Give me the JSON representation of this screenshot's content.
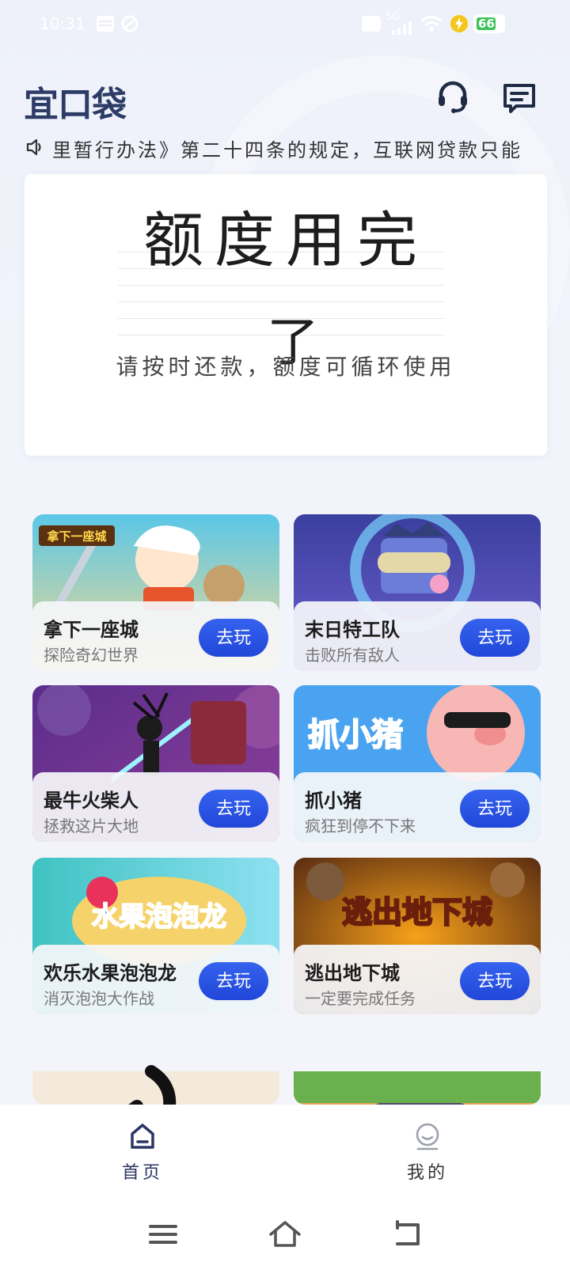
{
  "status_bar": {
    "time": "10:31",
    "battery": "66",
    "network": "5G"
  },
  "header": {
    "logo": "宜口袋",
    "service_icon": "headset-icon",
    "message_icon": "message-icon"
  },
  "notice": {
    "icon": "speaker-icon",
    "text": "里暂行办法》第二十四条的规定，互联网贷款只能"
  },
  "quota_card": {
    "title_line1": "额度用完",
    "title_line2": "了",
    "subtitle": "请按时还款，额度可循环使用"
  },
  "games": [
    {
      "name": "拿下一座城",
      "desc": "探险奇幻世界",
      "button": "去玩",
      "art_text": "拿下一座城"
    },
    {
      "name": "末日特工队",
      "desc": "击败所有敌人",
      "button": "去玩"
    },
    {
      "name": "最牛火柴人",
      "desc": "拯救这片大地",
      "button": "去玩"
    },
    {
      "name": "抓小猪",
      "desc": "疯狂到停不下来",
      "button": "去玩",
      "art_text": "抓小猪"
    },
    {
      "name": "欢乐水果泡泡龙",
      "desc": "消灭泡泡大作战",
      "button": "去玩",
      "art_text": "水果泡泡龙"
    },
    {
      "name": "逃出地下城",
      "desc": "一定要完成任务",
      "button": "去玩",
      "art_text": "逃出地下城"
    }
  ],
  "bottom_nav": {
    "home": "首页",
    "mine": "我的"
  },
  "colors": {
    "accent": "#2a4fe0",
    "logo": "#2c3c66",
    "active_nav": "#2c3566"
  }
}
